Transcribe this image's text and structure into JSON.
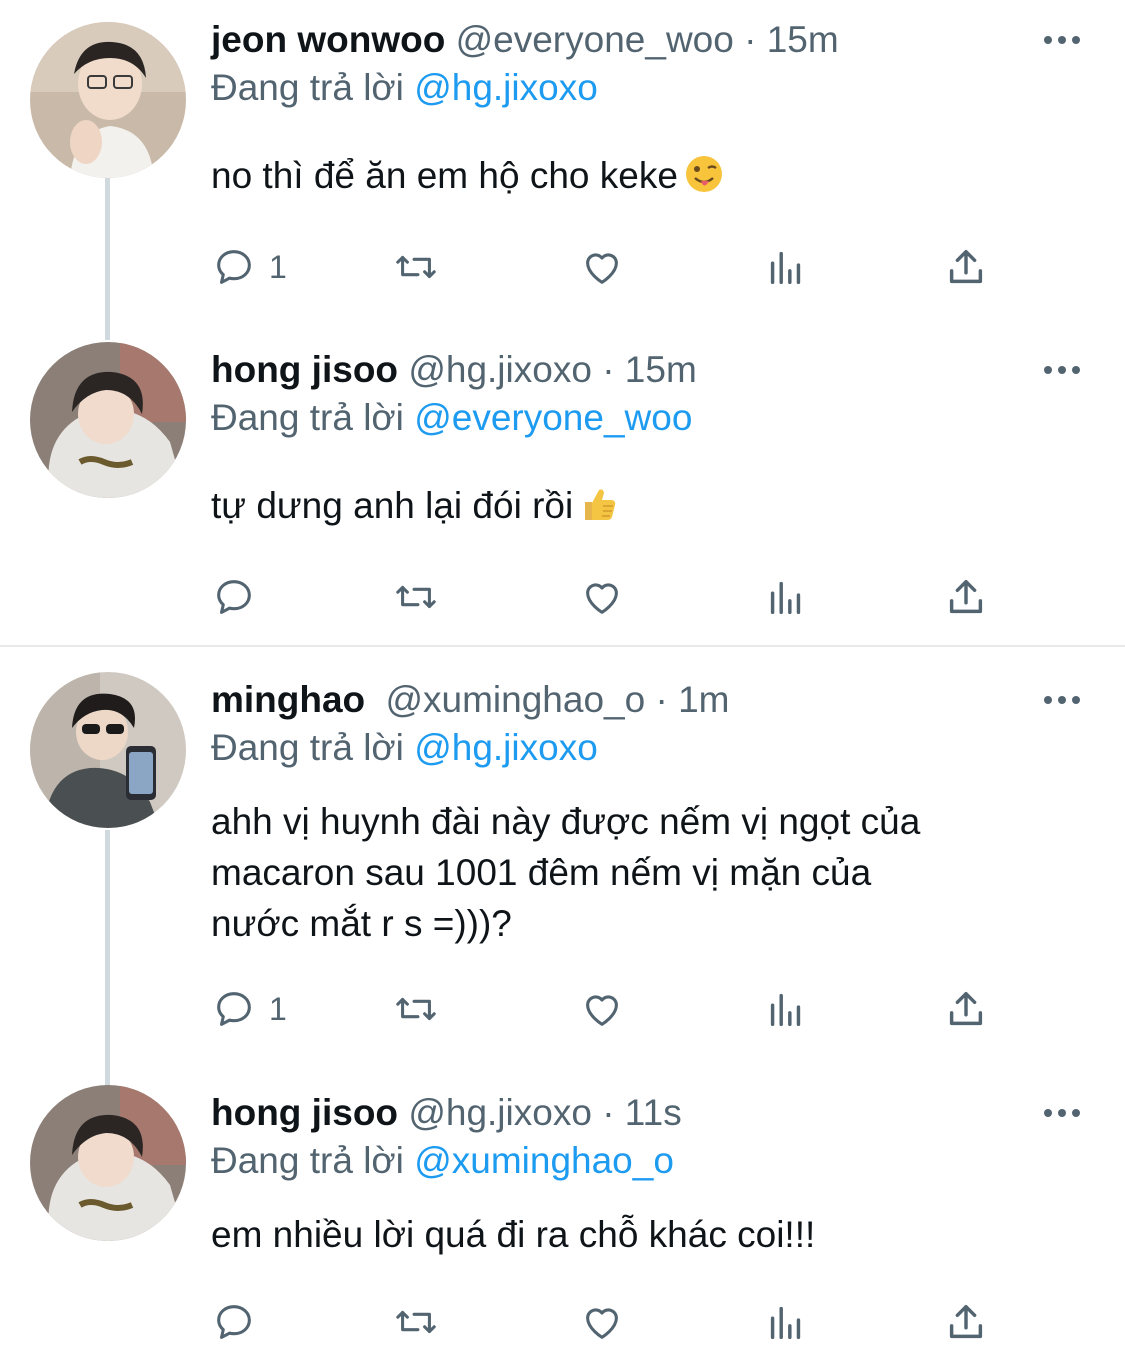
{
  "tweets": [
    {
      "name": "jeon wonwoo",
      "handle": "@everyone_woo",
      "dot": "·",
      "time": "15m",
      "reply_prefix": "Đang trả lời",
      "reply_to": "@hg.jixoxo",
      "text": "no thì để ăn em hộ cho keke",
      "emoji": "tongue-out-emoji",
      "reply_count": "1"
    },
    {
      "name": "hong jisoo",
      "handle": "@hg.jixoxo",
      "dot": "·",
      "time": "15m",
      "reply_prefix": "Đang trả lời",
      "reply_to": "@everyone_woo",
      "text": "tự dưng anh lại đói rồi",
      "emoji": "thumbs-up-emoji",
      "reply_count": ""
    },
    {
      "name": "minghao",
      "handle": "@xuminghao_o",
      "dot": "·",
      "time": "1m",
      "reply_prefix": "Đang trả lời",
      "reply_to": "@hg.jixoxo",
      "text_lines": [
        "ahh vị huynh đài này được nếm vị ngọt của",
        "macaron sau 1001 đêm nếm vị mặn của",
        "nước mắt r s =)))?"
      ],
      "reply_count": "1"
    },
    {
      "name": "hong jisoo",
      "handle": "@hg.jixoxo",
      "dot": "·",
      "time": "11s",
      "reply_prefix": "Đang trả lời",
      "reply_to": "@xuminghao_o",
      "text": "em nhiều lời quá đi ra chỗ khác coi!!!",
      "reply_count": ""
    }
  ],
  "icons": {
    "reply": "reply-bubble-icon",
    "retweet": "retweet-icon",
    "like": "heart-icon",
    "analytics": "analytics-bars-icon",
    "share": "share-upload-icon",
    "more": "more-dots-icon"
  },
  "colors": {
    "link": "#1d9bf0",
    "secondary_text": "#536471",
    "thread_line": "#cfd9de",
    "divider": "#e7e9ea"
  }
}
